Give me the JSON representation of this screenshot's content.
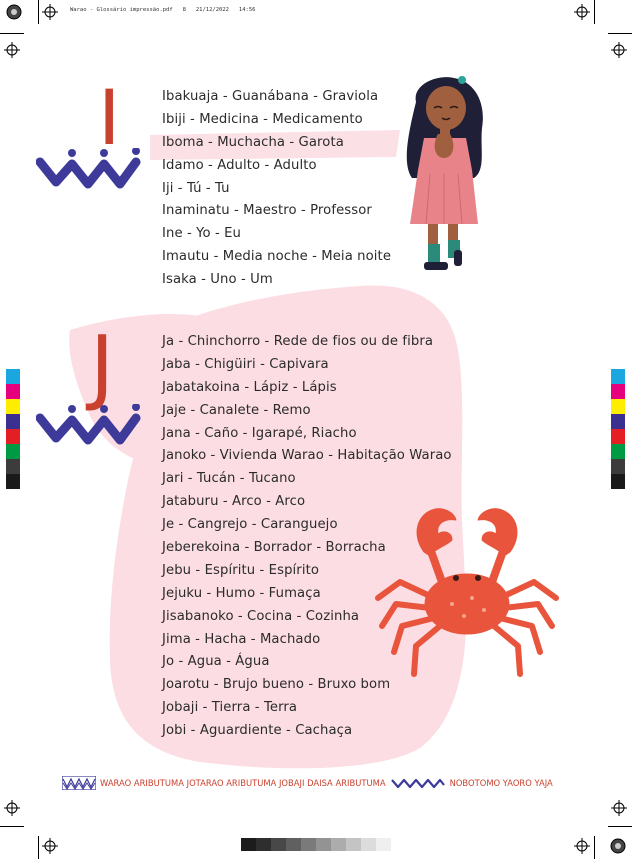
{
  "print_header": {
    "filename": "Warao - Glossário impressão.pdf",
    "page": "8",
    "date": "21/12/2022",
    "time": "14:56"
  },
  "sections": [
    {
      "letter": "I",
      "entries": [
        "Ibakuaja - Guanábana - Graviola",
        "Ibiji - Medicina - Medicamento",
        "Iboma - Muchacha - Garota",
        "Idamo - Adulto - Adulto",
        "Iji - Tú - Tu",
        "Inaminatu - Maestro - Professor",
        "Ine - Yo - Eu",
        "Imautu - Media noche - Meia noite",
        "Isaka - Uno - Um"
      ]
    },
    {
      "letter": "J",
      "entries": [
        "Ja - Chinchorro - Rede de fios ou de fibra",
        "Jaba - Chigüiri - Capivara",
        "Jabatakoina - Lápiz - Lápis",
        "Jaje - Canalete - Remo",
        "Jana - Caño - Igarapé, Riacho",
        "Janoko - Vivienda Warao - Habitação Warao",
        "Jari - Tucán - Tucano",
        "Jataburu - Arco - Arco",
        "Je - Cangrejo - Caranguejo",
        "Jeberekoina - Borrador - Borracha",
        "Jebu - Espíritu - Espírito",
        "Jejuku - Humo - Fumaça",
        "Jisabanoko - Cocina - Cozinha",
        "Jima - Hacha - Machado",
        "Jo - Agua - Água",
        "Joarotu - Brujo bueno - Bruxo bom",
        "Jobaji - Tierra - Terra",
        "Jobi - Aguardiente - Cachaça"
      ]
    }
  ],
  "footer": {
    "left_text": "WARAO ARIBUTUMA JOTARAO ARIBUTUMA JOBAJI DAISA ARIBUTUMA",
    "right_text": "NOBOTOMO YAORO YAJA"
  },
  "colors": {
    "accent_red": "#c9412e",
    "pattern_purple": "#3d3a9a",
    "blob_pink": "#fbdde3",
    "crab": "#e8553c"
  },
  "print_colorbar": [
    "#1aa7e0",
    "#e6007e",
    "#ffed00",
    "#3b2f8f",
    "#e31e24",
    "#009a44",
    "#3c3c3c",
    "#1a1a1a"
  ],
  "print_graybar": [
    "#1c1c1c",
    "#2e2e2e",
    "#484848",
    "#606060",
    "#7a7a7a",
    "#939393",
    "#acacac",
    "#c4c4c4",
    "#dcdcdc",
    "#efefef"
  ]
}
